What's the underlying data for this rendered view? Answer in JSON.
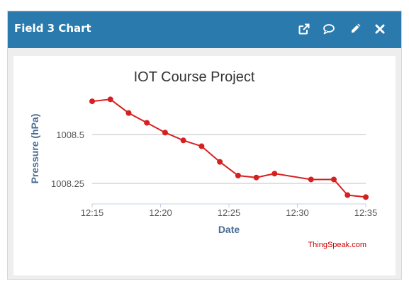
{
  "widget": {
    "title": "Field 3 Chart",
    "actions": [
      {
        "name": "open-new-window",
        "icon": "external-link-icon"
      },
      {
        "name": "comment",
        "icon": "comment-icon"
      },
      {
        "name": "edit",
        "icon": "pencil-icon"
      },
      {
        "name": "close",
        "icon": "close-icon"
      }
    ]
  },
  "colors": {
    "header": "#2a7aae",
    "line": "#d62020",
    "axis_text": "#555555",
    "axis_title": "#4a6d93",
    "credits": "#cc0000"
  },
  "credits": "ThingSpeak.com",
  "chart_data": {
    "type": "line",
    "title": "IOT Course Project",
    "xlabel": "Date",
    "ylabel": "Pressure (hPa)",
    "x_ticks": [
      "12:15",
      "12:20",
      "12:25",
      "12:30",
      "12:35"
    ],
    "y_ticks": [
      "1008.25",
      "1008.5"
    ],
    "grid": "horizontal",
    "series": [
      {
        "x": [
          "12:15:00",
          "12:16:20",
          "12:17:40",
          "12:19:00",
          "12:20:20",
          "12:21:40",
          "12:23:00",
          "12:24:20",
          "12:25:40",
          "12:27:00",
          "12:28:20",
          "12:31:00",
          "12:32:40",
          "12:33:40",
          "12:35:00"
        ],
        "values": [
          1008.67,
          1008.68,
          1008.61,
          1008.56,
          1008.51,
          1008.47,
          1008.44,
          1008.36,
          1008.29,
          1008.28,
          1008.3,
          1008.27,
          1008.27,
          1008.19,
          1008.18
        ]
      }
    ]
  }
}
